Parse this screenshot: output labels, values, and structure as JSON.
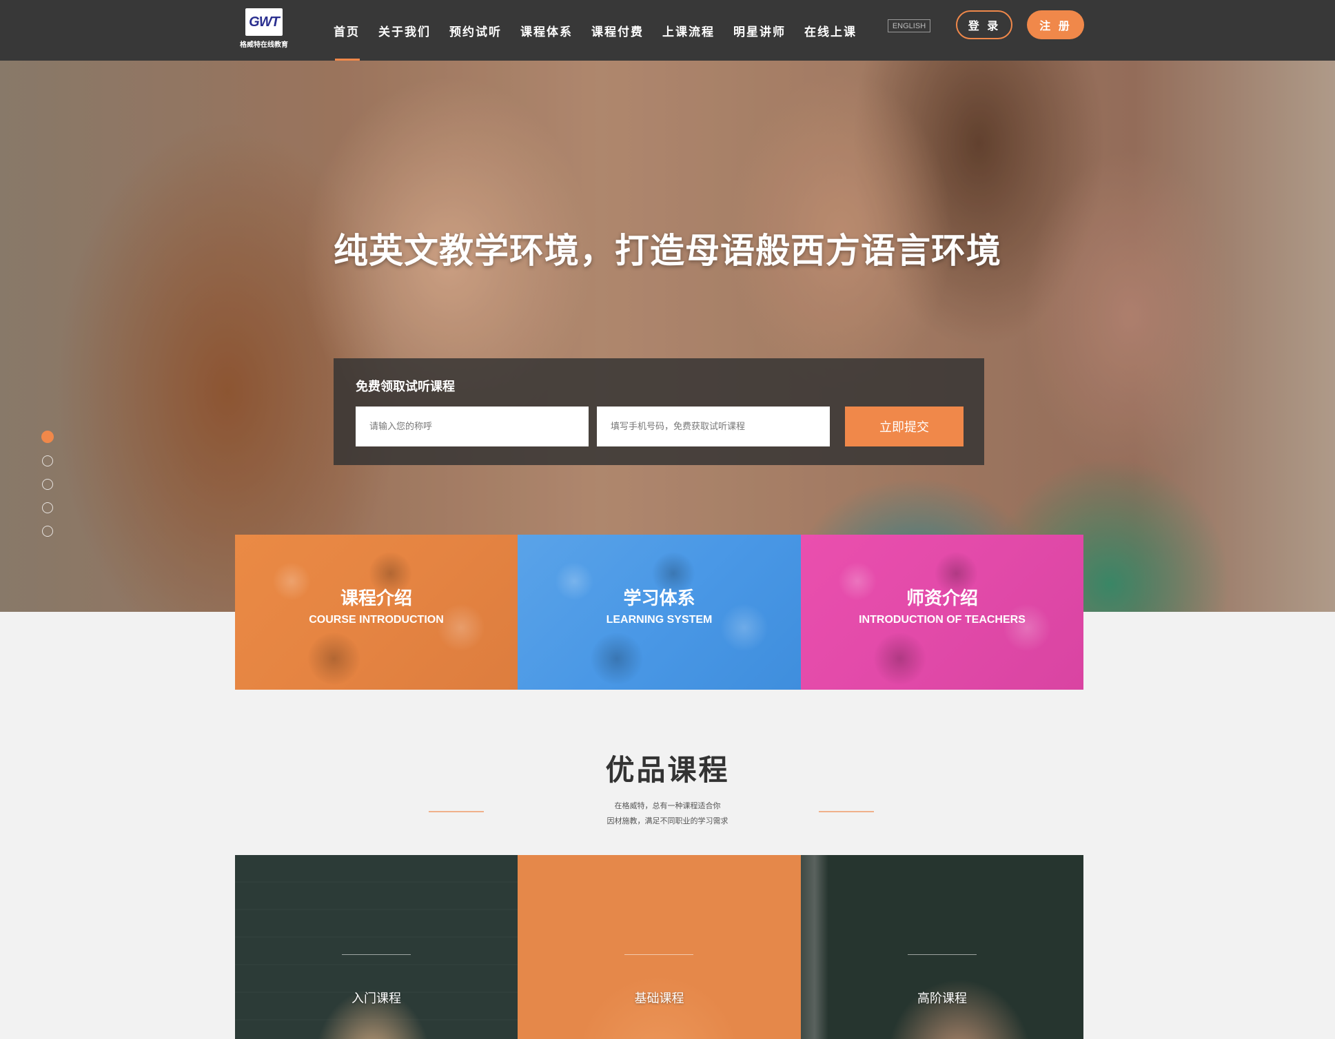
{
  "header": {
    "logo_text": "GWT",
    "logo_caption": "格威特在线教育",
    "nav": [
      "首页",
      "关于我们",
      "预约试听",
      "课程体系",
      "课程付费",
      "上课流程",
      "明星讲师",
      "在线上课"
    ],
    "active_nav": "首页",
    "lang_label": "ENGLISH",
    "login_label": "登 录",
    "register_label": "注 册",
    "accent_color": "#f0884a",
    "background_color": "#383838"
  },
  "hero": {
    "title": "纯英文教学环境，打造母语般西方语言环境",
    "trial_title": "免费领取试听课程",
    "name_placeholder": "请输入您的称呼",
    "phone_placeholder": "填写手机号码，免费获取试听课程",
    "submit_label": "立即提交",
    "slides_total": 5,
    "active_slide": 1
  },
  "features": [
    {
      "cn": "课程介绍",
      "en": "COURSE INTRODUCTION",
      "color": "#e58442"
    },
    {
      "cn": "学习体系",
      "en": "LEARNING SYSTEM",
      "color": "#4a98e6"
    },
    {
      "cn": "师资介绍",
      "en": "INTRODUCTION OF TEACHERS",
      "color": "#e24aa9"
    }
  ],
  "premium": {
    "title": "优品课程",
    "desc_line1": "在格威特，总有一种课程适合你",
    "desc_line2": "因材施教，满足不同职业的学习需求",
    "courses": [
      "入门课程",
      "基础课程",
      "高阶课程"
    ]
  }
}
